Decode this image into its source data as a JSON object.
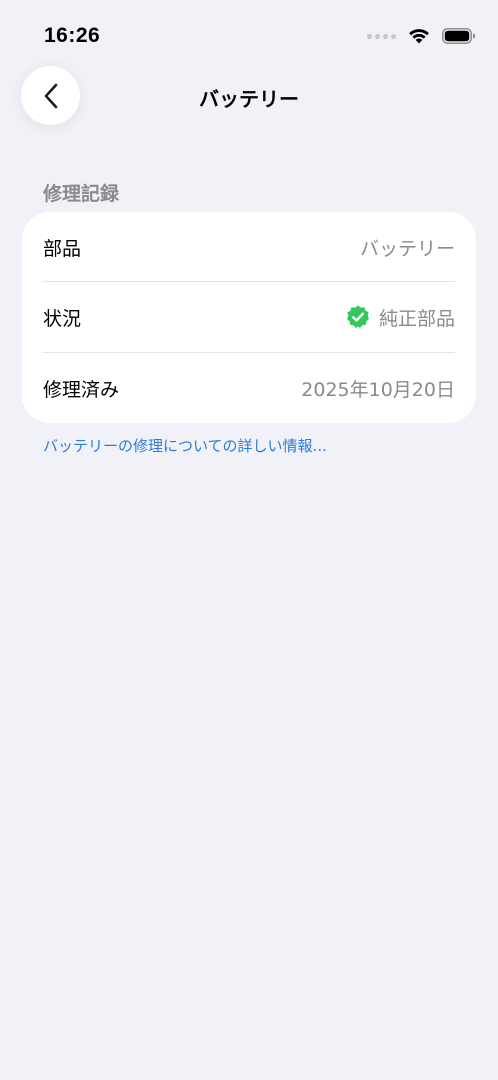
{
  "status_bar": {
    "time": "16:26"
  },
  "nav": {
    "title": "バッテリー"
  },
  "section": {
    "header": "修理記録"
  },
  "rows": [
    {
      "label": "部品",
      "value": "バッテリー"
    },
    {
      "label": "状況",
      "value": "純正部品",
      "icon": "verified-badge-icon"
    },
    {
      "label": "修理済み",
      "value": "2025年10月20日"
    }
  ],
  "footer": {
    "link": "バッテリーの修理についての詳しい情報..."
  },
  "colors": {
    "background": "#F1F2F7",
    "card": "#FFFFFF",
    "secondary_text": "#8A8A8E",
    "link": "#2E7BD6",
    "verified_green": "#34C759"
  }
}
